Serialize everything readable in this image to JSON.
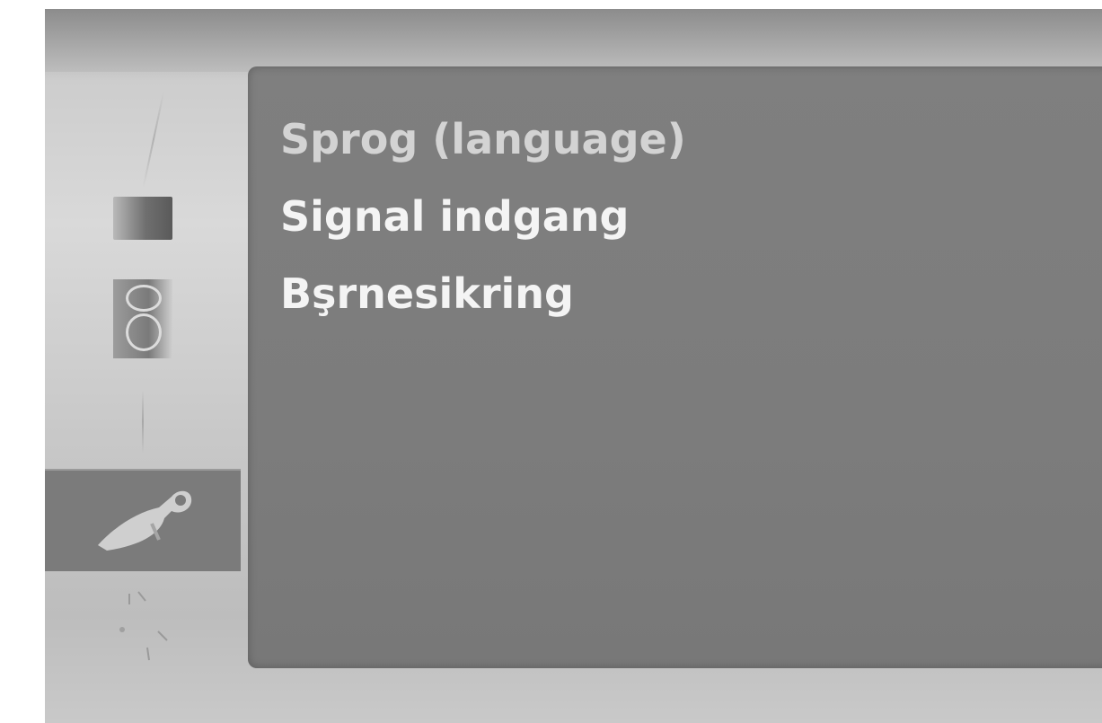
{
  "sidebar": {
    "items": [
      {
        "icon": "picture-icon",
        "selected": false
      },
      {
        "icon": "speaker-icon",
        "selected": false
      },
      {
        "icon": "clock-icon",
        "selected": false
      },
      {
        "icon": "wrench-icon",
        "selected": true
      },
      {
        "icon": "misc-icon",
        "selected": false
      }
    ]
  },
  "menu": {
    "items": [
      {
        "label": "Sprog (language)"
      },
      {
        "label": "Signal indgang"
      },
      {
        "label": "Bşrnesikring"
      }
    ]
  },
  "colors": {
    "panel": "#7f7f7f",
    "selected_tab": "#7b7b7b",
    "active_text": "#d3d3d3",
    "text": "#f4f4f4"
  }
}
